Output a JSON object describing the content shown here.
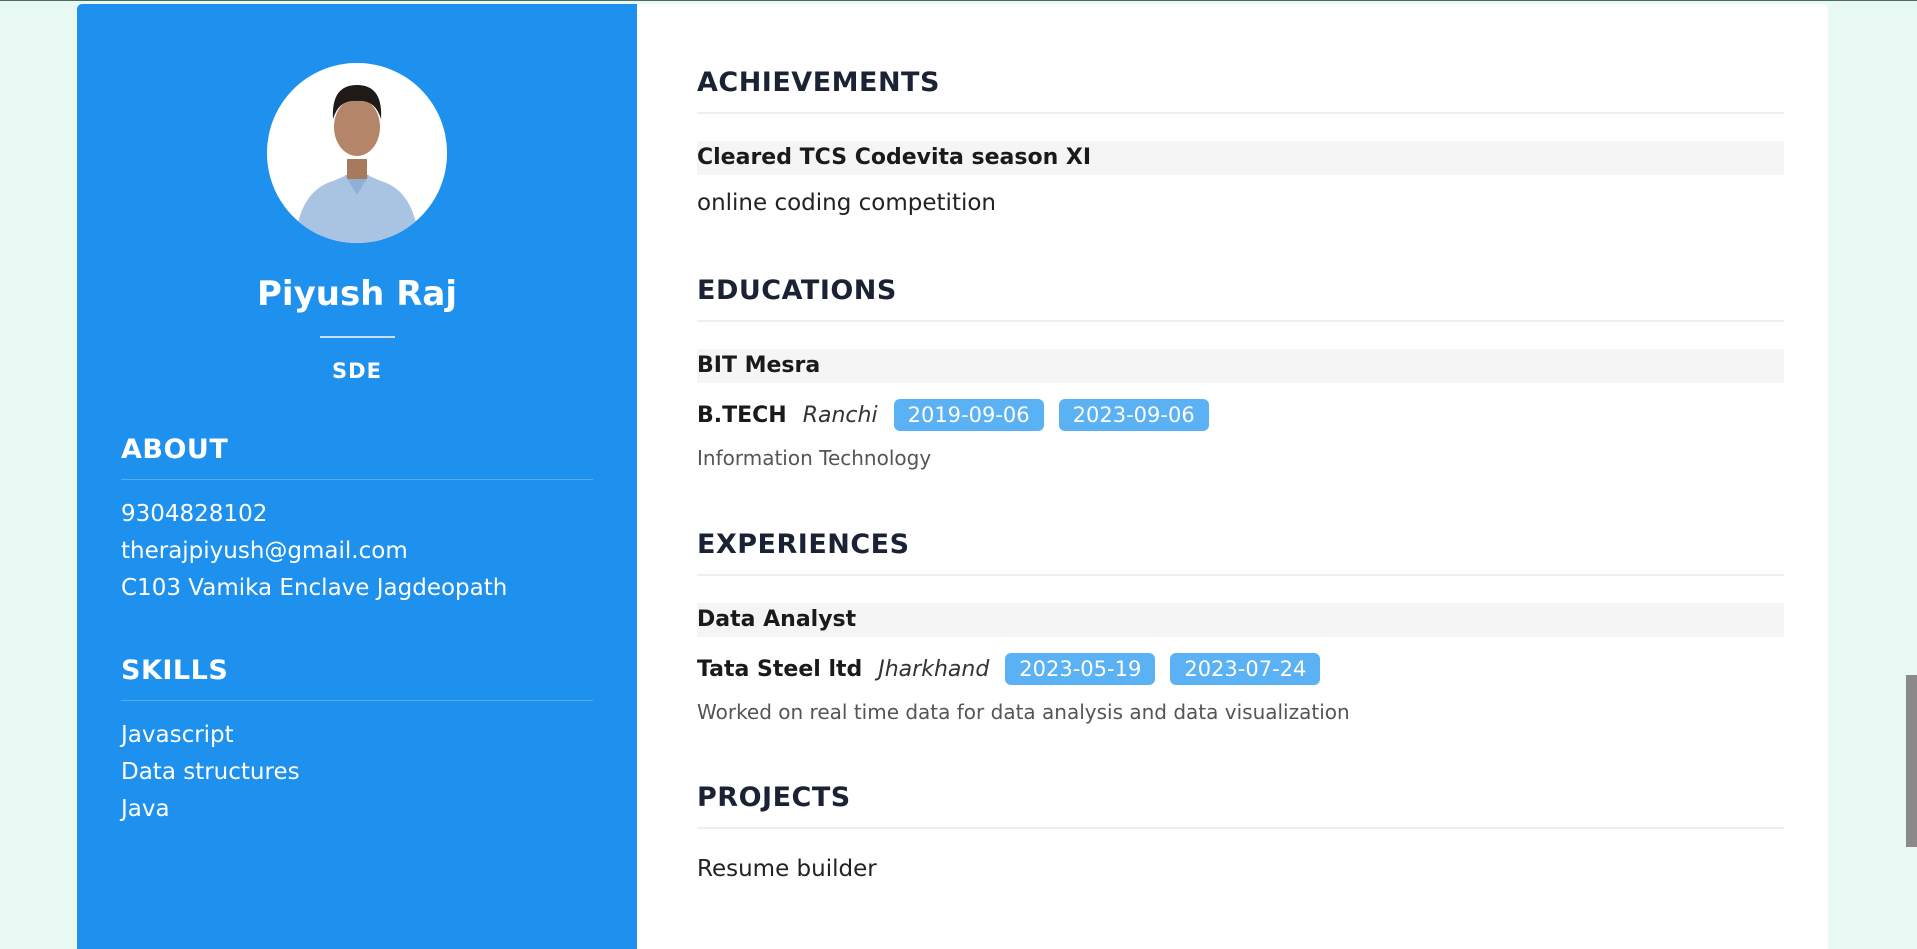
{
  "profile": {
    "name": "Piyush Raj",
    "role": "SDE"
  },
  "about": {
    "heading": "ABOUT",
    "phone": "9304828102",
    "email": "therajpiyush@gmail.com",
    "address": "C103 Vamika Enclave Jagdeopath"
  },
  "skills": {
    "heading": "SKILLS",
    "items": [
      "Javascript",
      "Data structures",
      "Java"
    ]
  },
  "achievements": {
    "heading": "ACHIEVEMENTS",
    "title": "Cleared TCS Codevita season XI",
    "subtitle": "online coding competition"
  },
  "educations": {
    "heading": "EDUCATIONS",
    "institute": "BIT Mesra",
    "degree": "B.TECH",
    "location": "Ranchi",
    "start": "2019-09-06",
    "end": "2023-09-06",
    "description": "Information Technology"
  },
  "experiences": {
    "heading": "EXPERIENCES",
    "title": "Data Analyst",
    "company": "Tata Steel ltd",
    "location": "Jharkhand",
    "start": "2023-05-19",
    "end": "2023-07-24",
    "description": "Worked on real time data for data analysis and data visualization"
  },
  "projects": {
    "heading": "PROJECTS",
    "items": [
      "Resume builder"
    ]
  },
  "colors": {
    "sidebar": "#1e90ee",
    "badge": "#5ab1f3",
    "page_background": "#e8f8f3"
  }
}
